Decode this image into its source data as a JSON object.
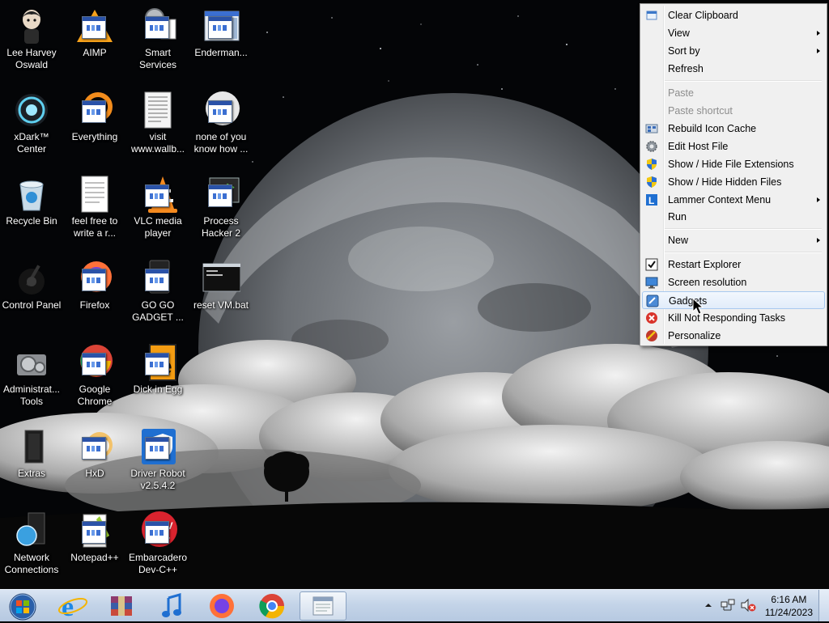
{
  "desktop": {
    "icons": [
      {
        "label": "Lee Harvey Oswald",
        "icon": "user-figure-icon"
      },
      {
        "label": "AIMP",
        "icon": "aimp-icon"
      },
      {
        "label": "Smart Services",
        "icon": "gears-icon"
      },
      {
        "label": "Enderman...",
        "icon": "window-icon"
      },
      {
        "label": "xDark™ Center",
        "icon": "orb-icon"
      },
      {
        "label": "Everything",
        "icon": "search-ring-icon"
      },
      {
        "label": "visit www.wallb...",
        "icon": "document-icon"
      },
      {
        "label": "none of you know how ...",
        "icon": "red-circle-icon"
      },
      {
        "label": "Recycle Bin",
        "icon": "recycle-bin-icon"
      },
      {
        "label": "feel free to write a r...",
        "icon": "document-icon"
      },
      {
        "label": "VLC media player",
        "icon": "vlc-cone-icon"
      },
      {
        "label": "Process Hacker 2",
        "icon": "monitor-icon"
      },
      {
        "label": "Control Panel",
        "icon": "control-panel-icon"
      },
      {
        "label": "Firefox",
        "icon": "firefox-icon"
      },
      {
        "label": "GO GO GADGET ...",
        "icon": "gadget-icon"
      },
      {
        "label": "reset VM.bat",
        "icon": "batch-file-icon"
      },
      {
        "label": "Administrat... Tools",
        "icon": "admin-tools-icon"
      },
      {
        "label": "Google Chrome",
        "icon": "chrome-icon"
      },
      {
        "label": "Dick in Egg",
        "icon": "egg-app-icon"
      },
      {
        "label": "Extras",
        "icon": "folder-icon"
      },
      {
        "label": "HxD",
        "icon": "hex-editor-icon"
      },
      {
        "label": "Driver Robot v2.5.4.2",
        "icon": "shield-icon"
      },
      {
        "label": "Network Connections",
        "icon": "network-icon"
      },
      {
        "label": "Notepad++",
        "icon": "notepad-icon"
      },
      {
        "label": "Embarcadero Dev-C++",
        "icon": "devcpp-icon"
      }
    ]
  },
  "context_menu": {
    "items": [
      {
        "label": "Clear Clipboard",
        "icon": "clipboard-icon",
        "disabled": false,
        "submenu": false
      },
      {
        "label": "View",
        "icon": "",
        "disabled": false,
        "submenu": true
      },
      {
        "label": "Sort by",
        "icon": "",
        "disabled": false,
        "submenu": true
      },
      {
        "label": "Refresh",
        "icon": "",
        "disabled": false,
        "submenu": false
      },
      {
        "label": "Paste",
        "icon": "",
        "disabled": true,
        "submenu": false
      },
      {
        "label": "Paste shortcut",
        "icon": "",
        "disabled": true,
        "submenu": false
      },
      {
        "label": "Rebuild Icon Cache",
        "icon": "icon-cache-icon",
        "disabled": false,
        "submenu": false
      },
      {
        "label": "Edit Host File",
        "icon": "gear-icon",
        "disabled": false,
        "submenu": false
      },
      {
        "label": "Show / Hide File Extensions",
        "icon": "uac-shield-icon",
        "disabled": false,
        "submenu": false
      },
      {
        "label": "Show / Hide Hidden Files",
        "icon": "uac-shield-icon",
        "disabled": false,
        "submenu": false
      },
      {
        "label": "Lammer Context Menu",
        "icon": "lammer-icon",
        "disabled": false,
        "submenu": true
      },
      {
        "label": "Run",
        "icon": "",
        "disabled": false,
        "submenu": false
      },
      {
        "label": "New",
        "icon": "",
        "disabled": false,
        "submenu": true
      },
      {
        "label": "Restart Explorer",
        "icon": "checkmark-icon",
        "disabled": false,
        "submenu": false
      },
      {
        "label": "Screen resolution",
        "icon": "screen-icon",
        "disabled": false,
        "submenu": false
      },
      {
        "label": "Gadgets",
        "icon": "gadgets-icon",
        "disabled": false,
        "submenu": false,
        "highlighted": true
      },
      {
        "label": "Kill Not Responding Tasks",
        "icon": "kill-icon",
        "disabled": false,
        "submenu": false
      },
      {
        "label": "Personalize",
        "icon": "personalize-icon",
        "disabled": false,
        "submenu": false
      }
    ]
  },
  "taskbar": {
    "items": [
      {
        "icon": "start-orb-icon"
      },
      {
        "icon": "internet-explorer-icon"
      },
      {
        "icon": "winrar-icon"
      },
      {
        "icon": "music-note-icon"
      },
      {
        "icon": "firefox-icon"
      },
      {
        "icon": "chrome-icon"
      },
      {
        "icon": "notepad-window-icon",
        "active": true
      }
    ],
    "clock": {
      "time": "6:16 AM",
      "date": "11/24/2023"
    },
    "tray": [
      "show-hidden-icons-chevron",
      "network-tray-icon",
      "volume-muted-icon"
    ]
  }
}
